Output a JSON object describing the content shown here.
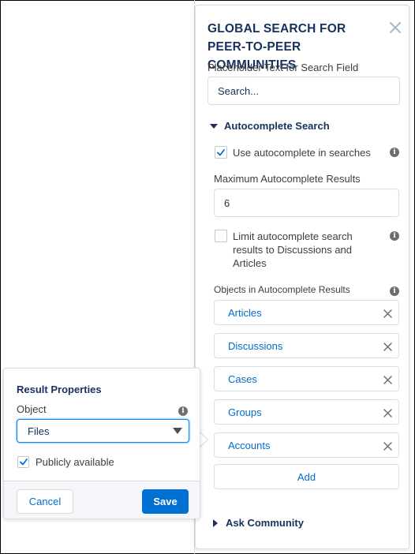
{
  "panel": {
    "title": "GLOBAL SEARCH FOR PEER-TO-PEER COMMUNITIES",
    "placeholder_label": "Placeholder Text for Search Field",
    "placeholder_value": "Search...",
    "autocomplete_section": {
      "label": "Autocomplete Search",
      "expanded": true,
      "use_autocomplete_label": "Use autocomplete in searches",
      "use_autocomplete_checked": true,
      "max_results_label": "Maximum Autocomplete Results",
      "max_results_value": "6",
      "limit_label": "Limit autocomplete search results to Discussions and Articles",
      "limit_checked": false,
      "objects_label": "Objects in Autocomplete Results",
      "objects": [
        {
          "label": "Articles"
        },
        {
          "label": "Discussions"
        },
        {
          "label": "Cases"
        },
        {
          "label": "Groups"
        },
        {
          "label": "Accounts"
        }
      ],
      "add_label": "Add"
    },
    "ask_section": {
      "label": "Ask Community",
      "expanded": false
    }
  },
  "popover": {
    "title": "Result Properties",
    "object_label": "Object",
    "object_value": "Files",
    "publicly_available_label": "Publicly available",
    "publicly_available_checked": true,
    "cancel_label": "Cancel",
    "save_label": "Save"
  },
  "icons": {
    "close": "close-icon",
    "info": "info-icon",
    "remove": "remove-icon",
    "chevron_down": "chevron-down-icon",
    "chevron_right": "chevron-right-icon",
    "check": "check-icon",
    "caret": "caret-down-icon"
  },
  "colors": {
    "brand": "#0070d2",
    "link": "#006dcc",
    "heading": "#16325c",
    "border": "#d8dde6"
  }
}
